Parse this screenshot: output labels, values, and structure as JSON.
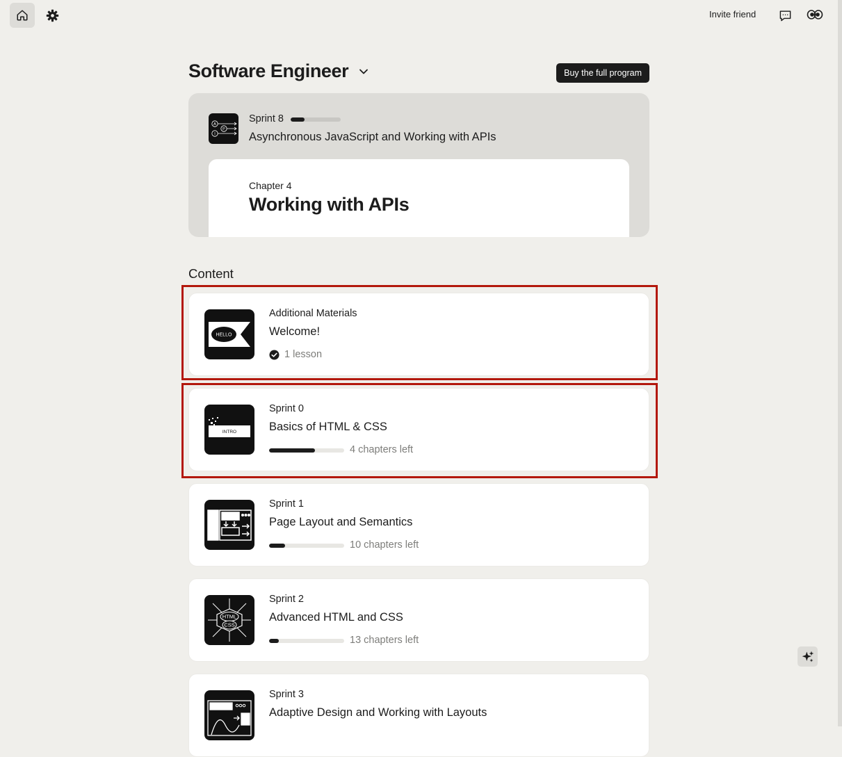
{
  "topbar": {
    "invite_label": "Invite friend"
  },
  "program": {
    "title": "Software Engineer",
    "buy_label": "Buy the full program"
  },
  "current": {
    "sprint_label": "Sprint 8",
    "sprint_progress": 0.28,
    "title": "Asynchronous JavaScript and Working with APIs",
    "thumb_letters": [
      "A",
      "P",
      "I"
    ],
    "chapter_label": "Chapter 4",
    "chapter_title": "Working with APIs"
  },
  "content": {
    "section_title": "Content",
    "items": [
      {
        "label": "Additional Materials",
        "title": "Welcome!",
        "status": "1 lesson",
        "thumb_text": "HELLO"
      },
      {
        "label": "Sprint 0",
        "title": "Basics of HTML & CSS",
        "progress": 0.61,
        "status": "4 chapters left",
        "thumb_text": "INTRO"
      },
      {
        "label": "Sprint 1",
        "title": "Page Layout and Semantics",
        "progress": 0.21,
        "status": "10 chapters left"
      },
      {
        "label": "Sprint 2",
        "title": "Advanced HTML and CSS",
        "progress": 0.13,
        "status": "13 chapters left",
        "thumb_text_1": "HTML",
        "thumb_text_2": "CSS"
      },
      {
        "label": "Sprint 3",
        "title": "Adaptive Design and Working with Layouts"
      }
    ]
  },
  "colors": {
    "background": "#f0efeb",
    "panel": "#dddcd8",
    "accent_dark": "#1c1c1c",
    "highlight": "#b3180c",
    "muted_text": "#7d7d7a"
  }
}
